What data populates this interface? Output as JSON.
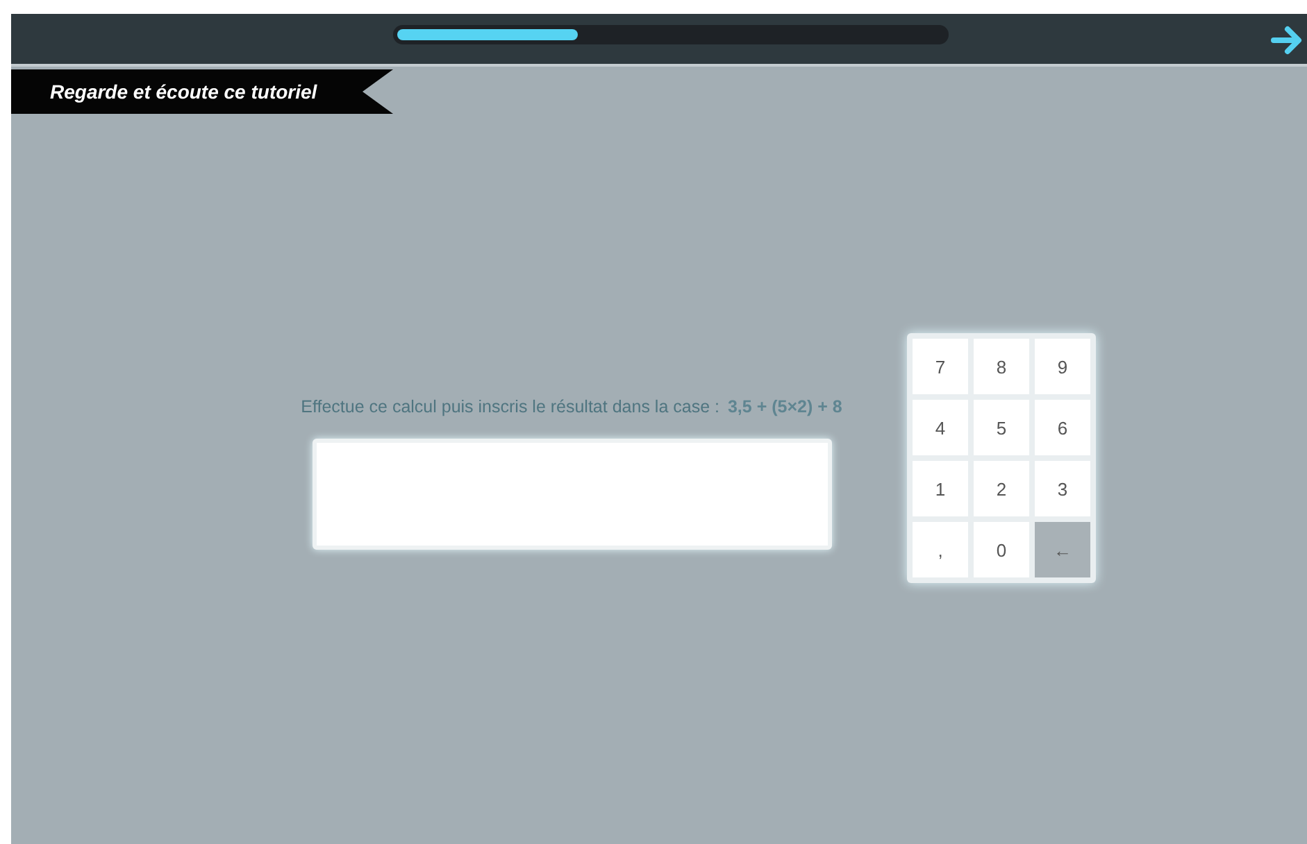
{
  "progress": {
    "level": 0.33
  },
  "banner": {
    "title": "Regarde et écoute ce tutoriel"
  },
  "question": {
    "text": "Effectue ce calcul puis inscris le résultat dans la case :",
    "expression": "3,5 + (5×2) + 8"
  },
  "keypad": [
    {
      "kind": "digit",
      "label": "7"
    },
    {
      "kind": "digit",
      "label": "8"
    },
    {
      "kind": "digit",
      "label": "9"
    },
    {
      "kind": "digit",
      "label": "4"
    },
    {
      "kind": "digit",
      "label": "5"
    },
    {
      "kind": "digit",
      "label": "6"
    },
    {
      "kind": "digit",
      "label": "1"
    },
    {
      "kind": "digit",
      "label": "2"
    },
    {
      "kind": "digit",
      "label": "3"
    },
    {
      "kind": "digit",
      "label": ","
    },
    {
      "kind": "digit",
      "label": "0"
    },
    {
      "kind": "backspace",
      "label": "←"
    }
  ]
}
